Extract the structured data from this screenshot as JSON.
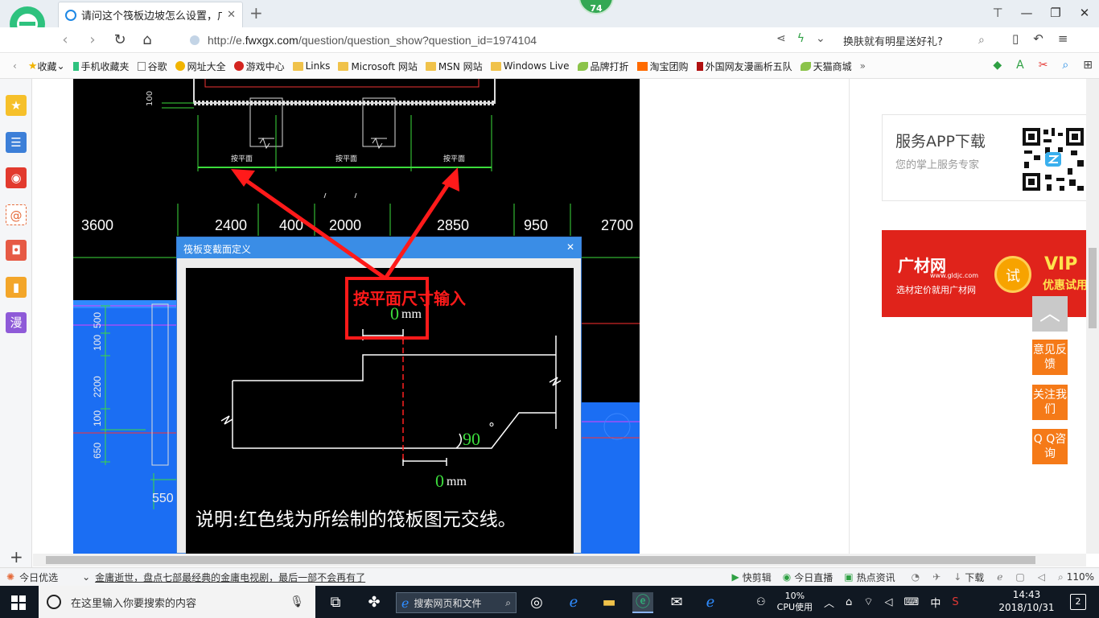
{
  "tab": {
    "title": "请问这个筏板边坡怎么设置，广",
    "close": "✕",
    "new_tab": "+"
  },
  "badge": "74",
  "window_controls": {
    "skin": "⊤",
    "minimize": "—",
    "restore": "❐",
    "close": "✕"
  },
  "address": {
    "url_prefix": "http://e.",
    "url_domain": "fwxgx.com",
    "url_path": "/question/question_show?question_id=1974104",
    "search_hint": "换肤就有明星送好礼?"
  },
  "bookmarks": [
    {
      "label": "收藏",
      "icon": "star-icon"
    },
    {
      "label": "手机收藏夹",
      "icon": "phone-icon"
    },
    {
      "label": "谷歌",
      "icon": "page-icon"
    },
    {
      "label": "网址大全",
      "icon": "site-icon"
    },
    {
      "label": "游戏中心",
      "icon": "game-icon"
    },
    {
      "label": "Links",
      "icon": "folder-icon"
    },
    {
      "label": "Microsoft 网站",
      "icon": "folder-icon"
    },
    {
      "label": "MSN 网站",
      "icon": "folder-icon"
    },
    {
      "label": "Windows Live",
      "icon": "folder-icon"
    },
    {
      "label": "品牌打折",
      "icon": "leaf-icon"
    },
    {
      "label": "淘宝团购",
      "icon": "taobao-icon"
    },
    {
      "label": "外国网友漫画析五队",
      "icon": "bookmark-icon"
    },
    {
      "label": "天猫商城",
      "icon": "leaf-icon"
    }
  ],
  "bookmark_more": "»",
  "cad": {
    "dims_top": [
      "3600",
      "2400",
      "400",
      "2000",
      "2850",
      "950",
      "2700"
    ],
    "label_100_top": "100",
    "small_labels": [
      "按平面",
      "按平面",
      "按平面"
    ],
    "left_dims": [
      "500",
      "100",
      "2200",
      "100",
      "650"
    ],
    "dim_550": "550",
    "dialog_title": "筏板变截面定义",
    "dialog_close": "✕",
    "annotation": "按平面尺寸输入",
    "value_top": "0",
    "unit_top": "mm",
    "value_angle": "90",
    "angle_unit": "°",
    "value_bottom": "0",
    "unit_bottom": "mm",
    "note": "说明:红色线为所绘制的筏板图元交线。"
  },
  "sidebar_right": {
    "app_title": "服务APP下载",
    "app_subtitle": "您的掌上服务专家",
    "ad_brand": "广材网",
    "ad_url": "www.gldjc.com",
    "ad_slogan": "选材定价就用广材网",
    "ad_try": "试",
    "ad_vip": "VIP",
    "ad_vip_sub": "优惠试用",
    "to_top": "︿",
    "feedback": "意见反馈",
    "follow": "关注我们",
    "qq": "Q Q咨询"
  },
  "statusbar": {
    "today": "今日优选",
    "news": "金庸逝世，盘点七部最经典的金庸电视剧，最后一部不会再有了",
    "quickcut": "快剪辑",
    "live": "今日直播",
    "hotnews": "热点资讯",
    "download": "下载",
    "zoom": "110%"
  },
  "taskbar": {
    "search_placeholder": "在这里输入你要搜索的内容",
    "web_search": "搜索网页和文件",
    "cpu_value": "10%",
    "cpu_label": "CPU使用",
    "ime": "中",
    "time": "14:43",
    "date": "2018/10/31",
    "notif_count": "2"
  },
  "colors": {
    "accent_green": "#33a853",
    "ad_red": "#e0231b",
    "float_orange": "#f57a18",
    "cad_green": "#3cdc3c",
    "cad_red": "#ff2020"
  }
}
